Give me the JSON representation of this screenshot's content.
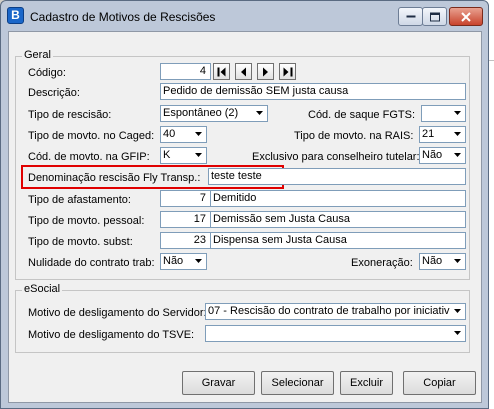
{
  "window": {
    "title": "Cadastro de Motivos de Rescisões",
    "icon_letter": "B"
  },
  "geral": {
    "legend": "Geral",
    "codigo": {
      "label": "Código:",
      "value": "4"
    },
    "descricao": {
      "label": "Descrição:",
      "value": "Pedido de demissão SEM justa causa"
    },
    "tipo_rescisao": {
      "label": "Tipo de rescisão:",
      "value": "Espontâneo (2)"
    },
    "cod_saque_fgts": {
      "label": "Cód. de saque FGTS:",
      "value": ""
    },
    "tipo_movto_caged": {
      "label": "Tipo de movto. no Caged:",
      "value": "40"
    },
    "tipo_movto_rais": {
      "label": "Tipo de movto. na RAIS:",
      "value": "21"
    },
    "cod_movto_gfip": {
      "label": "Cód. de movto. na GFIP:",
      "value": "K"
    },
    "exclusivo_conselheiro": {
      "label": "Exclusivo para conselheiro tutelar:",
      "value": "Não"
    },
    "denominacao_fly": {
      "label": "Denominação rescisão Fly Transp.:",
      "value": "teste teste"
    },
    "tipo_afastamento": {
      "label": "Tipo de afastamento:",
      "code": "7",
      "desc": "Demitido"
    },
    "tipo_movto_pessoal": {
      "label": "Tipo de movto. pessoal:",
      "code": "17",
      "desc": "Demissão sem Justa Causa"
    },
    "tipo_movto_subst": {
      "label": "Tipo de movto. subst:",
      "code": "23",
      "desc": "Dispensa sem Justa Causa"
    },
    "nulidade": {
      "label": "Nulidade do contrato trab:",
      "value": "Não"
    },
    "exoneracao": {
      "label": "Exoneração:",
      "value": "Não"
    }
  },
  "esocial": {
    "legend": "eSocial",
    "motivo_servidor": {
      "label": "Motivo de desligamento do Servidor:",
      "value": "07 - Rescisão do contrato de trabalho por iniciativa"
    },
    "motivo_tsve": {
      "label": "Motivo de desligamento do TSVE:",
      "value": ""
    }
  },
  "buttons": {
    "gravar": "Gravar",
    "selecionar": "Selecionar",
    "excluir": "Excluir",
    "copiar": "Copiar"
  },
  "colors": {
    "highlight": "#e00000",
    "titlebar": "#bdc8d9"
  }
}
